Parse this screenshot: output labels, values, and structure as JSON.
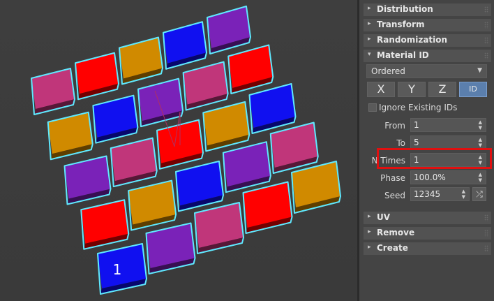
{
  "colors": {
    "pink": "#c0367a",
    "orange": "#d08a00",
    "purple": "#7a22b8",
    "red": "#ff0000",
    "blue": "#1010f0",
    "highlight": "#e01010",
    "selection_outline": "#5fe9ff"
  },
  "viewport": {
    "cube_label": "1",
    "grid": [
      [
        "pink",
        "red",
        "orange",
        "blue",
        "purple"
      ],
      [
        "orange",
        "blue",
        "purple",
        "pink",
        "red"
      ],
      [
        "purple",
        "pink",
        "red",
        "orange",
        "blue"
      ],
      [
        "red",
        "orange",
        "blue",
        "purple",
        "pink"
      ],
      [
        "blue",
        "purple",
        "pink",
        "red",
        "orange"
      ]
    ]
  },
  "rollouts_top": [
    {
      "label": "Distribution"
    },
    {
      "label": "Transform"
    },
    {
      "label": "Randomization"
    },
    {
      "label": "Material ID"
    }
  ],
  "material_id": {
    "mode": "Ordered",
    "axis_buttons": [
      "X",
      "Y",
      "Z",
      "ID"
    ],
    "ignore_label": "Ignore Existing IDs",
    "from_label": "From",
    "from_value": "1",
    "to_label": "To",
    "to_value": "5",
    "ntimes_label": "N Times",
    "ntimes_value": "1",
    "phase_label": "Phase",
    "phase_value": "100.0%",
    "seed_label": "Seed",
    "seed_value": "12345"
  },
  "rollouts_bottom": [
    {
      "label": "UV"
    },
    {
      "label": "Remove"
    },
    {
      "label": "Create"
    }
  ]
}
